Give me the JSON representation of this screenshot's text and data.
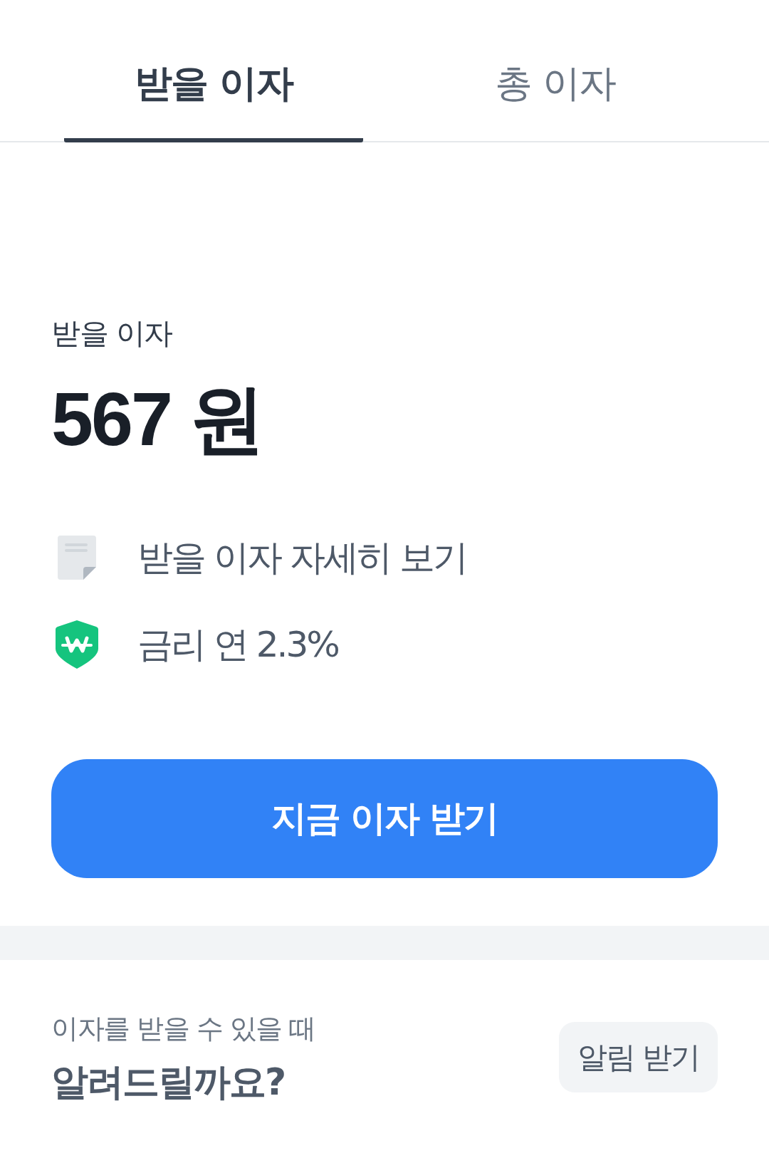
{
  "tabs": [
    {
      "label": "받을 이자",
      "selected": true
    },
    {
      "label": "총 이자",
      "selected": false
    }
  ],
  "interest": {
    "label": "받을 이자",
    "amount": "567 원"
  },
  "links": [
    {
      "kind": "document",
      "label": "받을 이자 자세히 보기"
    },
    {
      "kind": "shield",
      "label": "금리 연 2.3%"
    }
  ],
  "primary_button": "지금 이자 받기",
  "notify": {
    "subtitle": "이자를 받을 수 있을 때",
    "title": "알려드릴까요?",
    "button": "알림 받기"
  }
}
